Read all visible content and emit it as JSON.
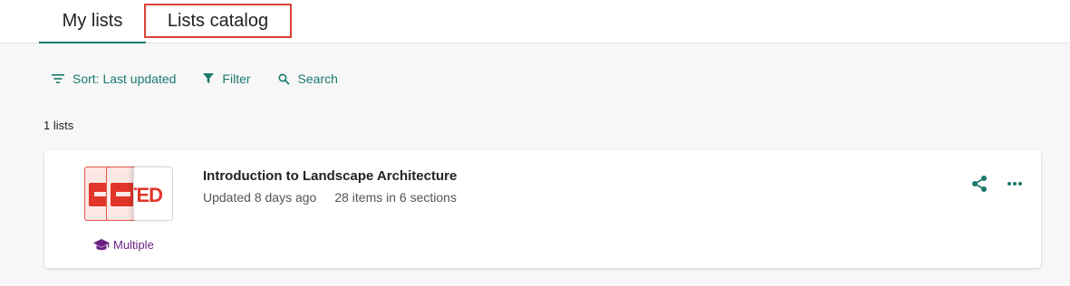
{
  "tabs": {
    "my_lists": "My lists",
    "lists_catalog": "Lists catalog"
  },
  "toolbar": {
    "sort_label": "Sort: Last updated",
    "filter_label": "Filter",
    "search_label": "Search"
  },
  "list_count": "1 lists",
  "lists": [
    {
      "title": "Introduction to Landscape Architecture",
      "updated": "Updated 8 days ago",
      "items": "28 items in 6 sections",
      "badge": "Multiple",
      "thumbnail_text": "TED",
      "icons": [
        "share-icon",
        "more-icon",
        "graduation-cap-icon"
      ]
    }
  ],
  "colors": {
    "accent": "#1b7a6d",
    "badge": "#6a2180",
    "highlight_border": "#d9433b",
    "logo_red": "#e1352b"
  }
}
